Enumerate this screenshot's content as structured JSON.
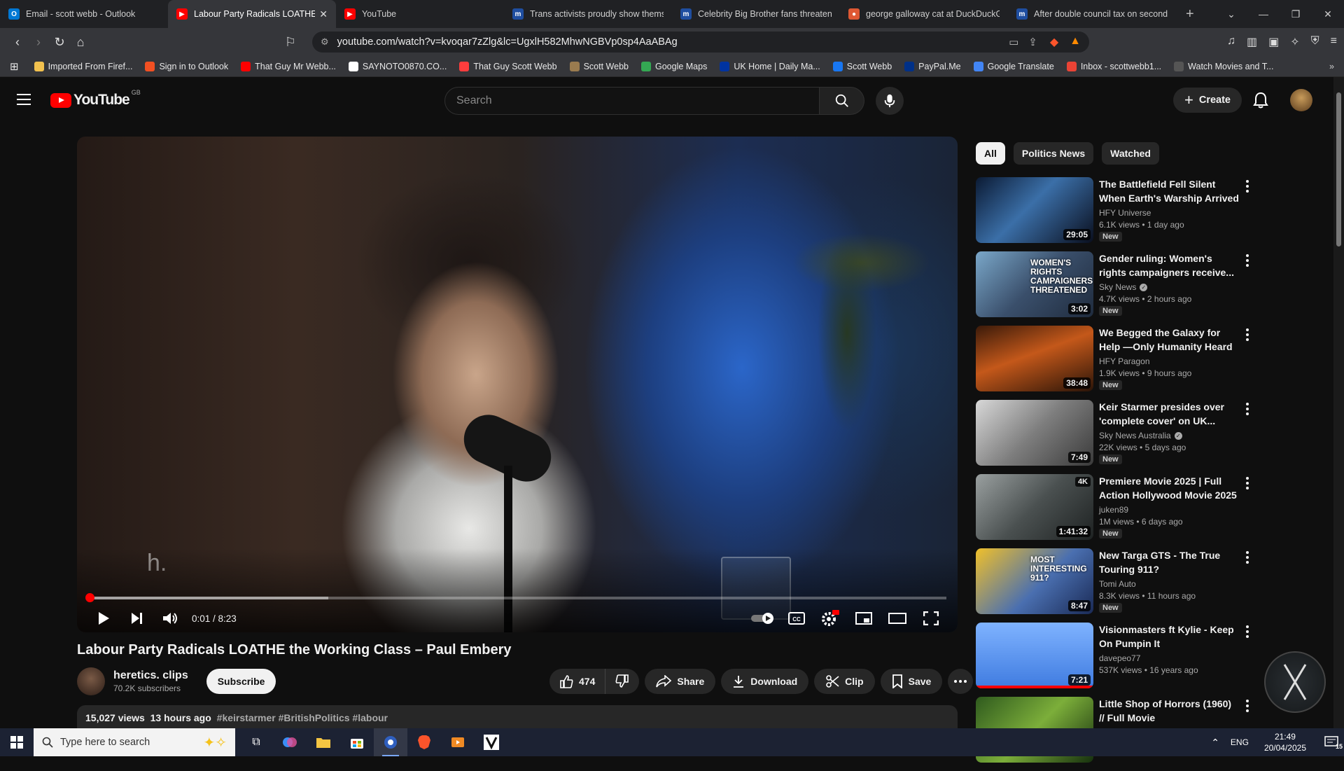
{
  "browser": {
    "tabs": [
      {
        "title": "Email - scott webb - Outlook",
        "icon": "outlook-icon",
        "active": false
      },
      {
        "title": "Labour Party Radicals LOATHE t",
        "icon": "youtube-icon",
        "active": true
      },
      {
        "title": "YouTube",
        "icon": "youtube-icon",
        "active": false
      },
      {
        "title": "Trans activists proudly show thems",
        "icon": "dailymail-icon",
        "active": false
      },
      {
        "title": "Celebrity Big Brother fans threaten",
        "icon": "dailymail-icon",
        "active": false
      },
      {
        "title": "george galloway cat at DuckDuckG",
        "icon": "duckduckgo-icon",
        "active": false
      },
      {
        "title": "After double council tax on second",
        "icon": "dailymail-icon",
        "active": false
      }
    ],
    "url": "youtube.com/watch?v=kvoqar7zZlg&lc=UgxlH582MhwNGBVp0sp4AaABAg",
    "bookmarks": [
      {
        "label": "Imported From Firef...",
        "color": "#f2c14e"
      },
      {
        "label": "Sign in to Outlook",
        "color": "#f25022"
      },
      {
        "label": "That Guy Mr Webb...",
        "color": "#ff0000"
      },
      {
        "label": "SAYNOTO0870.CO...",
        "color": "#ffffff"
      },
      {
        "label": "That Guy Scott Webb",
        "color": "#ff3d3d"
      },
      {
        "label": "Scott Webb",
        "color": "#9a7b4f"
      },
      {
        "label": "Google Maps",
        "color": "#34a853"
      },
      {
        "label": "UK Home | Daily Ma...",
        "color": "#0033a0"
      },
      {
        "label": "Scott Webb",
        "color": "#1877f2"
      },
      {
        "label": "PayPal.Me",
        "color": "#003087"
      },
      {
        "label": "Google Translate",
        "color": "#4285f4"
      },
      {
        "label": "Inbox - scottwebb1...",
        "color": "#ea4335"
      },
      {
        "label": "Watch Movies and T...",
        "color": "#555555"
      }
    ]
  },
  "youtube": {
    "region": "GB",
    "search_placeholder": "Search",
    "create_label": "Create"
  },
  "player": {
    "watermark": "h.",
    "time": "0:01 / 8:23",
    "progress_fraction": 0.002,
    "buffered_fraction": 0.28
  },
  "video": {
    "title": "Labour Party Radicals LOATHE the Working Class – Paul Embery",
    "channel": "heretics. clips",
    "subscribers": "70.2K subscribers",
    "subscribe_label": "Subscribe",
    "likes": "474",
    "share_label": "Share",
    "download_label": "Download",
    "clip_label": "Clip",
    "save_label": "Save",
    "views": "15,027 views",
    "age": "13 hours ago",
    "tags": "#keirstarmer #BritishPolitics #labour"
  },
  "chips": [
    "All",
    "Politics News",
    "Watched"
  ],
  "recommendations": [
    {
      "title": "The Battlefield Fell Silent When Earth's Warship Arrived",
      "channel": "HFY Universe",
      "verified": false,
      "views": "6.1K views",
      "age": "1 day ago",
      "duration": "29:05",
      "new": "New",
      "thumb": "linear-gradient(135deg,#0b1a33,#3b6fa8 45%,#0a0f1e)"
    },
    {
      "title": "Gender ruling: Women's rights campaigners receive...",
      "channel": "Sky News",
      "verified": true,
      "views": "4.7K views",
      "age": "2 hours ago",
      "duration": "3:02",
      "new": "New",
      "thumb": "linear-gradient(135deg,#7aa7c9,#3a4f6b 50%,#1f2b3d)",
      "thumb_text": "WOMEN'S RIGHTS CAMPAIGNERS THREATENED"
    },
    {
      "title": "We Begged the Galaxy for Help —Only Humanity Heard Our Cr...",
      "channel": "HFY Paragon",
      "verified": false,
      "views": "1.9K views",
      "age": "9 hours ago",
      "duration": "38:48",
      "new": "New",
      "thumb": "linear-gradient(160deg,#3a1a0a,#c4581a 45%,#2a1408)"
    },
    {
      "title": "Keir Starmer presides over 'complete cover' on UK...",
      "channel": "Sky News Australia",
      "verified": true,
      "views": "22K views",
      "age": "5 days ago",
      "duration": "7:49",
      "new": "New",
      "thumb": "linear-gradient(135deg,#d8d8d8,#7d7d7d 50%,#3a3a3a)"
    },
    {
      "title": "Premiere Movie 2025 | Full Action Hollywood Movie 2025 ...",
      "channel": "juken89",
      "verified": false,
      "views": "1M views",
      "age": "6 days ago",
      "duration": "1:41:32",
      "new": "New",
      "badge": "4K",
      "thumb": "linear-gradient(135deg,#9aa0a0,#4a5050 50%,#1e2222)"
    },
    {
      "title": "New Targa GTS - The True Touring 911?",
      "channel": "Tomi Auto",
      "verified": false,
      "views": "8.3K views",
      "age": "11 hours ago",
      "duration": "8:47",
      "new": "New",
      "thumb": "linear-gradient(135deg,#f0c02a,#4a6fb0 55%,#1a2a55)",
      "thumb_text": "MOST INTERESTING 911?"
    },
    {
      "title": "Visionmasters ft Kylie - Keep On Pumpin It",
      "channel": "davepeo77",
      "verified": false,
      "views": "537K views",
      "age": "16 years ago",
      "duration": "7:21",
      "new": "",
      "watched": true,
      "thumb": "linear-gradient(180deg,#7fb3ff,#3f7be0)"
    },
    {
      "title": "Little Shop of Horrors (1960) // Full Movie",
      "channel": "",
      "verified": false,
      "views": "",
      "age": "",
      "duration": "",
      "new": "",
      "thumb": "linear-gradient(135deg,#2f5a1e,#7cae3a 50%,#16300e)"
    }
  ],
  "taskbar": {
    "search_placeholder": "Type here to search",
    "language": "ENG",
    "time": "21:49",
    "date": "20/04/2025",
    "notifications": "15"
  }
}
